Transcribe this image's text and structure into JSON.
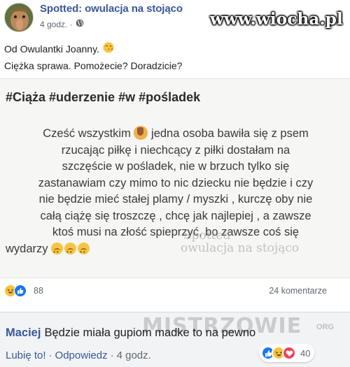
{
  "post": {
    "page_name": "Spotted: owulacja na stojąco",
    "time": "4 godz. ·",
    "watermark": "www.wiocha.pl",
    "line1": "Od Owulantki Joanny.",
    "line2": "Ciężka sprawa. Pomożecie? Doradzicie?"
  },
  "card": {
    "title": "#Ciąża #uderzenie #w #pośladek",
    "lines": [
      "Cześć wszystkim",
      "jedna osoba bawiła się z psem",
      "rzucając piłkę i niechcący z piłki dostałam na",
      "szczęście w pośladek,  nie w brzuch tylko się",
      "zastanawiam czy mimo to nic dziecku nie będzie i czy",
      "nie będzie mieć stałej plamy / myszki , kurczę oby nie",
      "całą ciążę się troszczę , chcę jak najlepiej , a zawsze",
      "ktoś musi na złość spieprzyć, bo zawsze coś się",
      "wydarzy"
    ],
    "watermark_line1": "Spotted",
    "watermark_line2": "owulacja na stojąco"
  },
  "stats": {
    "reactions": "88",
    "comments": "24 komentarze"
  },
  "comment": {
    "author": "Maciej",
    "text": "Będzie miała gupiom madke to na pewno",
    "watermark": "MISTRZOWIE",
    "watermark_small": "ORG",
    "like": "Lubię to!",
    "reply": "Odpowiedz",
    "time": "4 godz.",
    "reaction_count": "40"
  },
  "colors": {
    "link": "#385898",
    "like": "#1877f2",
    "haha": "#f7c33b",
    "love": "#f33e58"
  }
}
